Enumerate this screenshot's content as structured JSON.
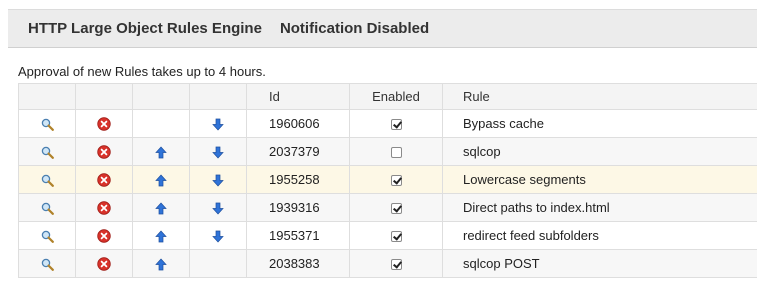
{
  "header": {
    "title": "HTTP Large Object Rules Engine",
    "status": "Notification Disabled"
  },
  "note": "Approval of new Rules takes up to 4 hours.",
  "table": {
    "columns": [
      "",
      "",
      "",
      "",
      "Id",
      "Enabled",
      "Rule"
    ],
    "rows": [
      {
        "id": "1960606",
        "enabled": true,
        "rule": "Bypass cache",
        "up": false,
        "down": true,
        "state": ""
      },
      {
        "id": "2037379",
        "enabled": false,
        "rule": "sqlcop",
        "up": true,
        "down": true,
        "state": "stripe"
      },
      {
        "id": "1955258",
        "enabled": true,
        "rule": "Lowercase segments",
        "up": true,
        "down": true,
        "state": "highlight"
      },
      {
        "id": "1939316",
        "enabled": true,
        "rule": "Direct paths to index.html",
        "up": true,
        "down": true,
        "state": "stripe"
      },
      {
        "id": "1955371",
        "enabled": true,
        "rule": "redirect feed subfolders",
        "up": true,
        "down": true,
        "state": ""
      },
      {
        "id": "2038383",
        "enabled": true,
        "rule": "sqlcop POST",
        "up": true,
        "down": false,
        "state": "stripe"
      }
    ]
  },
  "icons": {
    "view": "magnifier-icon",
    "delete": "delete-icon",
    "up": "arrow-up-icon",
    "down": "arrow-down-icon"
  },
  "colors": {
    "delete": "#d8322a",
    "arrow": "#2f73d8",
    "highlight_row": "#fdf8e6"
  }
}
